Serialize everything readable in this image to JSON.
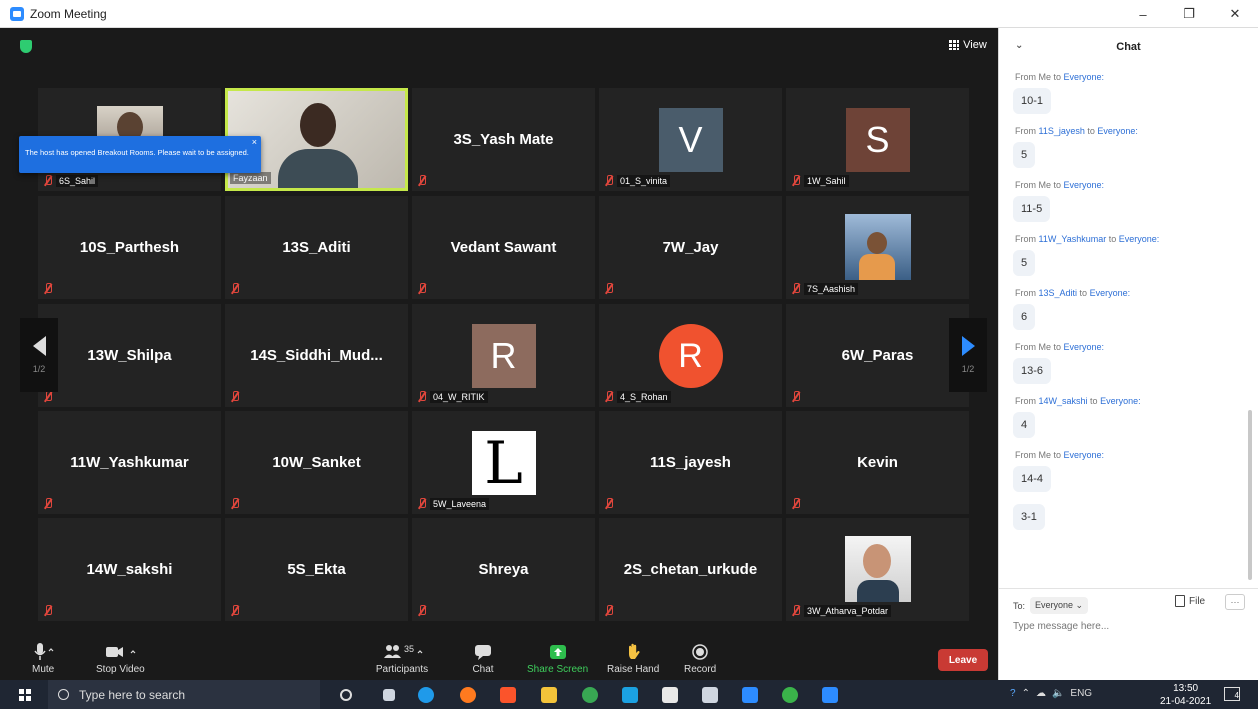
{
  "window": {
    "title": "Zoom Meeting",
    "controls": [
      "–",
      "❐",
      "✕"
    ]
  },
  "meeting": {
    "view_label": "View",
    "notification": "The host has opened Breakout Rooms. Please wait to be assigned.",
    "page_indicator": "1/2",
    "tiles": [
      {
        "label": "6S_Sahil",
        "kind": "video",
        "colors": [
          "#6a5a4a",
          "#c9b9a8"
        ]
      },
      {
        "label": "Fayzaan",
        "kind": "active-video"
      },
      {
        "display_name": "3S_Yash Mate",
        "kind": "name"
      },
      {
        "label": "01_S_vinita",
        "kind": "avatar",
        "letter": "V",
        "color": "#4a5c6b"
      },
      {
        "label": "1W_Sahil",
        "kind": "avatar",
        "letter": "S",
        "color": "#6e4337"
      },
      {
        "display_name": "10S_Parthesh",
        "kind": "name"
      },
      {
        "display_name": "13S_Aditi",
        "kind": "name"
      },
      {
        "display_name": "Vedant Sawant",
        "kind": "name"
      },
      {
        "display_name": "7W_Jay",
        "kind": "name"
      },
      {
        "label": "7S_Aashish",
        "kind": "photo"
      },
      {
        "display_name": "13W_Shilpa",
        "kind": "name"
      },
      {
        "display_name": "14S_Siddhi_Mud...",
        "kind": "name"
      },
      {
        "label": "04_W_RITIK",
        "kind": "avatar",
        "letter": "R",
        "color": "#8d6b5e"
      },
      {
        "label": "4_S_Rohan",
        "kind": "avatar-circle",
        "letter": "R",
        "color": "#f0522f"
      },
      {
        "display_name": "6W_Paras",
        "kind": "name"
      },
      {
        "display_name": "11W_Yashkumar",
        "kind": "name"
      },
      {
        "display_name": "10W_Sanket",
        "kind": "name"
      },
      {
        "label": "5W_Laveena",
        "kind": "letter-image",
        "letter": "L"
      },
      {
        "display_name": "11S_jayesh",
        "kind": "name"
      },
      {
        "display_name": "Kevin",
        "kind": "name"
      },
      {
        "display_name": "14W_sakshi",
        "kind": "name"
      },
      {
        "display_name": "5S_Ekta",
        "kind": "name"
      },
      {
        "display_name": "Shreya",
        "kind": "name"
      },
      {
        "display_name": "2S_chetan_urkude",
        "kind": "name"
      },
      {
        "label": "3W_Atharva_Potdar",
        "kind": "photo2"
      }
    ]
  },
  "toolbar": {
    "mute": "Mute",
    "stop_video": "Stop Video",
    "participants": "Participants",
    "participants_count": "35",
    "chat": "Chat",
    "share_screen": "Share Screen",
    "raise_hand": "Raise Hand",
    "record": "Record",
    "leave": "Leave"
  },
  "chat": {
    "title": "Chat",
    "messages": [
      {
        "from": "From Me to",
        "to": "Everyone:",
        "text": "10-1"
      },
      {
        "from": "From",
        "sender": "11S_jayesh",
        "to_prefix": " to ",
        "to": "Everyone:",
        "text": "5"
      },
      {
        "from": "From Me to",
        "to": "Everyone:",
        "text": "11-5"
      },
      {
        "from": "From",
        "sender": "11W_Yashkumar",
        "to_prefix": " to ",
        "to": "Everyone:",
        "text": "5"
      },
      {
        "from": "From",
        "sender": "13S_Aditi",
        "to_prefix": " to ",
        "to": "Everyone:",
        "text": "6"
      },
      {
        "from": "From Me to",
        "to": "Everyone:",
        "text": "13-6"
      },
      {
        "from": "From",
        "sender": "14W_sakshi",
        "to_prefix": " to ",
        "to": "Everyone:",
        "text": "4"
      },
      {
        "from": "From Me to",
        "to": "Everyone:",
        "text": "14-4"
      },
      {
        "text": "3-1"
      }
    ],
    "to_label": "To:",
    "recipient": "Everyone",
    "file_label": "File",
    "more_label": "···",
    "input_placeholder": "Type message here..."
  },
  "taskbar": {
    "search_placeholder": "Type here to search",
    "language": "ENG",
    "time": "13:50",
    "date": "21-04-2021",
    "notification_count": "4"
  }
}
